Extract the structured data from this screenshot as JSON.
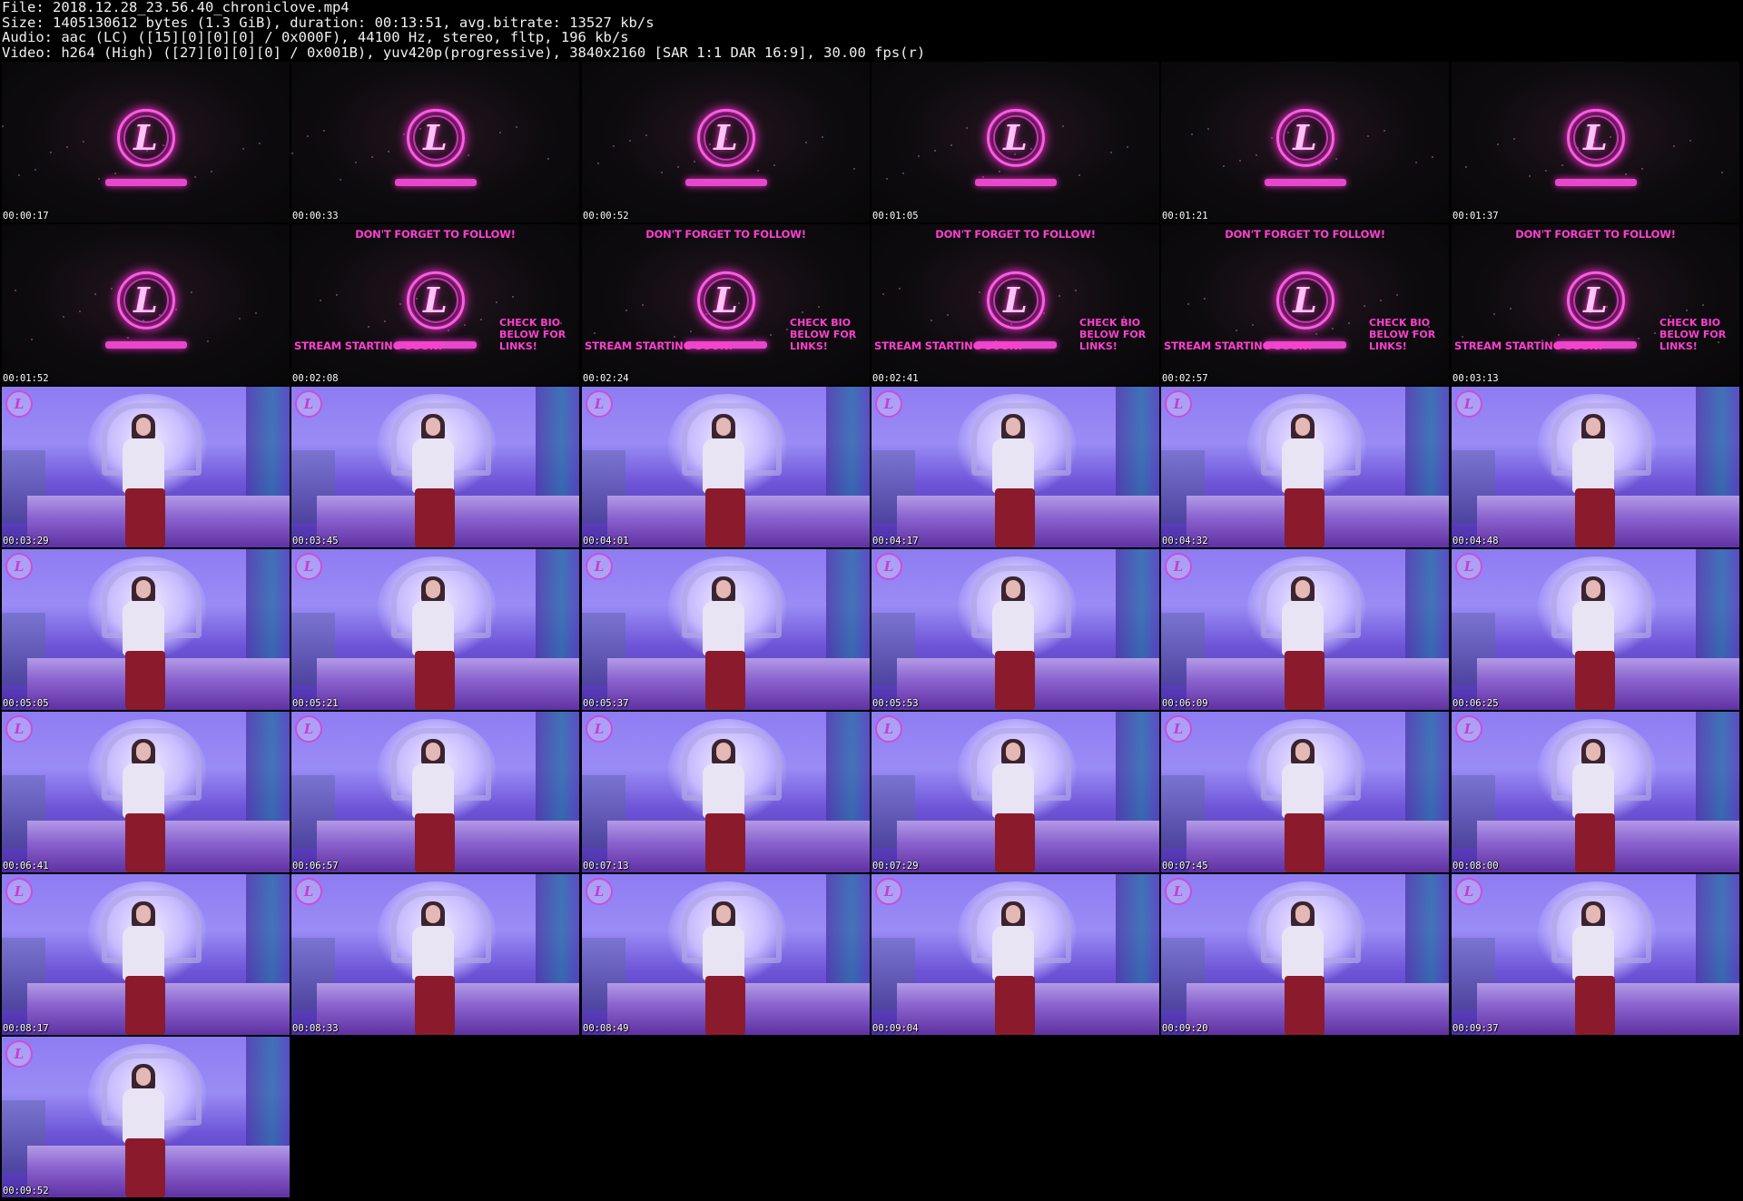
{
  "header": {
    "line1": "File: 2018.12.28_23.56.40_chroniclove.mp4",
    "line2": "Size: 1405130612 bytes (1.3 GiB), duration: 00:13:51, avg.bitrate: 13527 kb/s",
    "line3": "Audio: aac (LC) ([15][0][0][0] / 0x000F), 44100 Hz, stereo, fltp, 196 kb/s",
    "line4": "Video: h264 (High) ([27][0][0][0] / 0x001B), yuv420p(progressive), 3840x2160 [SAR 1:1 DAR 16:9], 30.00 fps(r)"
  },
  "overlay": {
    "follow": "DON'T FORGET TO FOLLOW!",
    "check": "CHECK BIO BELOW FOR LINKS!",
    "starting": "STREAM STARTING SOON!",
    "logo_letter": "L"
  },
  "thumbnails": [
    {
      "time": "00:00:17",
      "kind": "intro"
    },
    {
      "time": "00:00:33",
      "kind": "intro"
    },
    {
      "time": "00:00:52",
      "kind": "intro"
    },
    {
      "time": "00:01:05",
      "kind": "intro"
    },
    {
      "time": "00:01:21",
      "kind": "intro"
    },
    {
      "time": "00:01:37",
      "kind": "intro"
    },
    {
      "time": "00:01:52",
      "kind": "intro"
    },
    {
      "time": "00:02:08",
      "kind": "promo"
    },
    {
      "time": "00:02:24",
      "kind": "promo"
    },
    {
      "time": "00:02:41",
      "kind": "promo"
    },
    {
      "time": "00:02:57",
      "kind": "promo"
    },
    {
      "time": "00:03:13",
      "kind": "promo"
    },
    {
      "time": "00:03:29",
      "kind": "room"
    },
    {
      "time": "00:03:45",
      "kind": "room"
    },
    {
      "time": "00:04:01",
      "kind": "room"
    },
    {
      "time": "00:04:17",
      "kind": "room"
    },
    {
      "time": "00:04:32",
      "kind": "room"
    },
    {
      "time": "00:04:48",
      "kind": "room"
    },
    {
      "time": "00:05:05",
      "kind": "room"
    },
    {
      "time": "00:05:21",
      "kind": "room"
    },
    {
      "time": "00:05:37",
      "kind": "room"
    },
    {
      "time": "00:05:53",
      "kind": "room"
    },
    {
      "time": "00:06:09",
      "kind": "room"
    },
    {
      "time": "00:06:25",
      "kind": "room"
    },
    {
      "time": "00:06:41",
      "kind": "room"
    },
    {
      "time": "00:06:57",
      "kind": "room"
    },
    {
      "time": "00:07:13",
      "kind": "room"
    },
    {
      "time": "00:07:29",
      "kind": "room"
    },
    {
      "time": "00:07:45",
      "kind": "room"
    },
    {
      "time": "00:08:00",
      "kind": "room"
    },
    {
      "time": "00:08:17",
      "kind": "room"
    },
    {
      "time": "00:08:33",
      "kind": "room"
    },
    {
      "time": "00:08:49",
      "kind": "room"
    },
    {
      "time": "00:09:04",
      "kind": "room"
    },
    {
      "time": "00:09:20",
      "kind": "room"
    },
    {
      "time": "00:09:37",
      "kind": "room"
    },
    {
      "time": "00:09:52",
      "kind": "room"
    }
  ]
}
